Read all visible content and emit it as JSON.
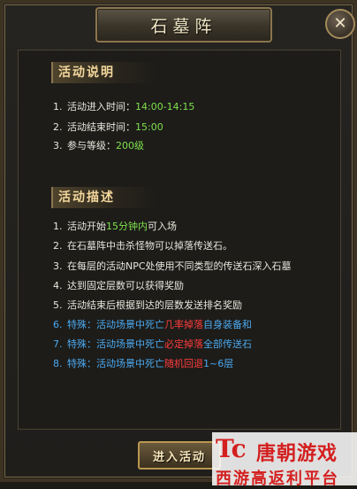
{
  "window": {
    "title": "石墓阵",
    "close_glyph": "✕"
  },
  "sections": {
    "info": {
      "heading": "活动说明",
      "items": [
        {
          "num": "1.",
          "label": "活动进入时间：",
          "value": "14:00-14:15"
        },
        {
          "num": "2.",
          "label": "活动结束时间：",
          "value": "15:00"
        },
        {
          "num": "3.",
          "label": "参与等级：",
          "value": "200级"
        }
      ]
    },
    "desc": {
      "heading": "活动描述",
      "items": [
        {
          "num": "1.",
          "a": "活动开始",
          "b": "15分钟内",
          "c": "可入场"
        },
        {
          "num": "2.",
          "a": "在石墓阵中击杀怪物可以掉落传送石。"
        },
        {
          "num": "3.",
          "a": "在每层的活动NPC处使用不同类型的传送石深入石墓"
        },
        {
          "num": "4.",
          "a": "达到固定层数可以获得奖励"
        },
        {
          "num": "5.",
          "a": "活动结束后根据到达的层数发送排名奖励"
        },
        {
          "num": "6.",
          "a": "特殊：活动场景中死亡",
          "b": "几率掉落",
          "c": "自身装备和"
        },
        {
          "num": "7.",
          "a": "特殊：活动场景中死亡",
          "b": "必定掉落",
          "c": "全部传送石"
        },
        {
          "num": "8.",
          "a": "特殊：活动场景中死亡",
          "b": "随机回退",
          "c": "1~6层"
        }
      ]
    }
  },
  "enter_button": {
    "label": "进入活动"
  },
  "watermark": {
    "logo": "Tc",
    "line1": "唐朝游戏",
    "line2": "西游高返利平台"
  },
  "colors": {
    "highlight_green": "#7ee04c",
    "special_blue": "#4ba9f0",
    "warning_red": "#ff3c3c",
    "heading_gold": "#f3d79b"
  }
}
